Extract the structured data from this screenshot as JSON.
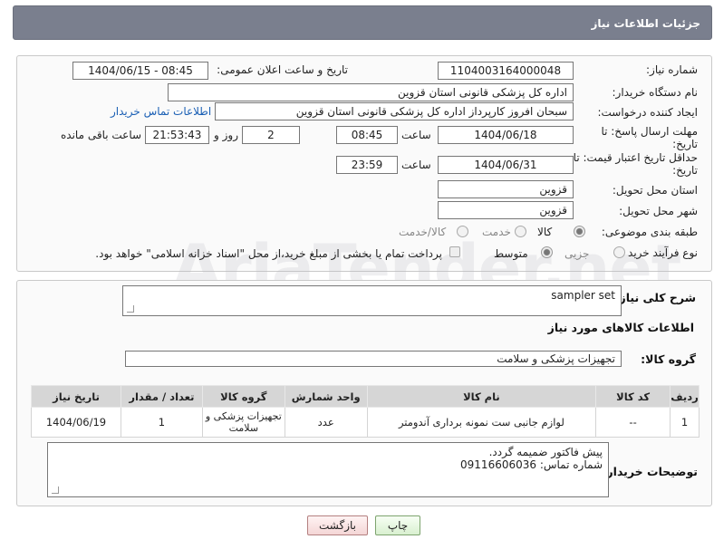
{
  "header": {
    "title": "جزئیات اطلاعات نیاز"
  },
  "info": {
    "need_number_label": "شماره نیاز:",
    "need_number": "1104003164000048",
    "announce_label": "تاریخ و ساعت اعلان عمومی:",
    "announce_value": "1404/06/15 - 08:45",
    "buyer_org_label": "نام دستگاه خریدار:",
    "buyer_org": "اداره کل پزشکی قانونی استان قزوین",
    "requester_label": "ایجاد کننده درخواست:",
    "requester": "سبحان افروز کارپرداز اداره کل پزشکی قانونی استان قزوین",
    "contact_link": "اطلاعات تماس خریدار",
    "deadline_label": "مهلت ارسال پاسخ: تا تاریخ:",
    "deadline_date": "1404/06/18",
    "time_label": "ساعت",
    "deadline_time": "08:45",
    "days_value": "2",
    "days_label": "روز و",
    "remaining_value": "21:53:43",
    "remaining_label": "ساعت باقی مانده",
    "min_validity_label": "حداقل تاریخ اعتبار قیمت: تا تاریخ:",
    "validity_date": "1404/06/31",
    "validity_time": "23:59",
    "province_label": "استان محل تحویل:",
    "province": "قزوین",
    "city_label": "شهر محل تحویل:",
    "city": "قزوین",
    "category_label": "طبقه بندی موضوعی:",
    "category_options": [
      "کالا",
      "خدمت",
      "کالا/خدمت"
    ],
    "process_label": "نوع فرآیند خرید :",
    "process_options": [
      "جزیی",
      "متوسط"
    ],
    "payment_note": "پرداخت تمام یا بخشی از مبلغ خرید،از محل \"اسناد خزانه اسلامی\" خواهد بود."
  },
  "need": {
    "summary_label": "شرح کلی نیاز:",
    "summary_value": "sampler set",
    "goods_info_title": "اطلاعات کالاهای مورد نیاز",
    "goods_group_label": "گروه کالا:",
    "goods_group_value": "تجهیزات پزشکی و سلامت"
  },
  "table": {
    "headers": [
      "ردیف",
      "کد کالا",
      "نام کالا",
      "واحد شمارش",
      "گروه کالا",
      "تعداد / مقدار",
      "تاریخ نیاز"
    ],
    "rows": [
      [
        "1",
        "--",
        "لوازم جانبی ست نمونه برداری آندومتر",
        "عدد",
        "تجهیزات پزشکی و سلامت",
        "1",
        "1404/06/19"
      ]
    ]
  },
  "buyer_notes": {
    "label": "توضیحات خریدار:",
    "line1": "پیش فاکتور ضمیمه گردد.",
    "line2": "شماره تماس: 09116606036"
  },
  "buttons": {
    "print": "چاپ",
    "back": "بازگشت"
  },
  "watermark": "AriaTender.net"
}
